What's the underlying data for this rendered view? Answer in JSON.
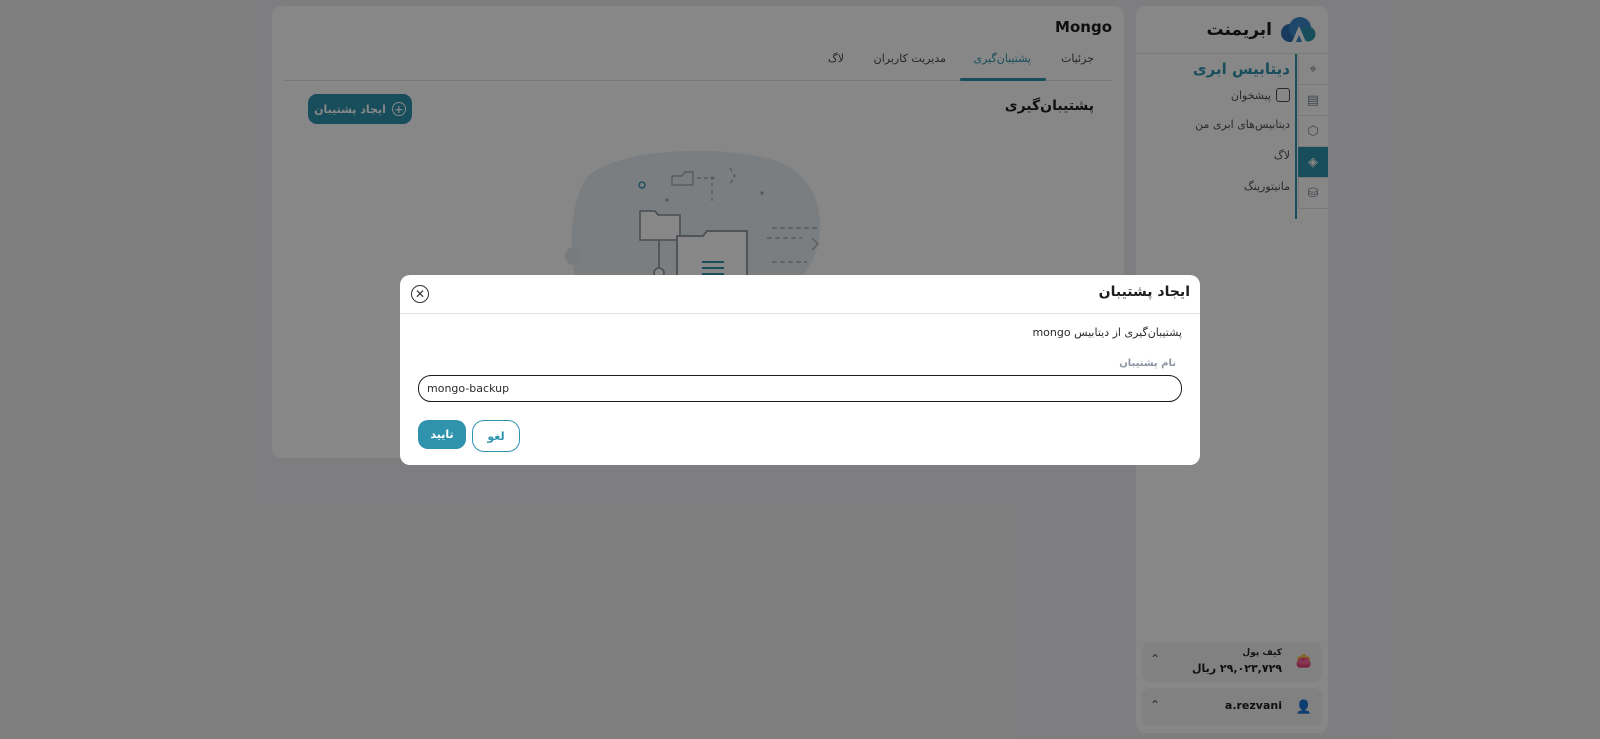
{
  "brand": {
    "name": "ابریمنت",
    "accent": "#2f93ae"
  },
  "sidebar": {
    "section_title": "دیتابیس ابری",
    "items": [
      {
        "label": "پیشخوان",
        "icon": "dashboard-icon"
      },
      {
        "label": "دیتابیس‌های ابری من"
      },
      {
        "label": "لاگ"
      },
      {
        "label": "مانیتورینگ"
      }
    ],
    "rail_icons": [
      "crosshair-icon",
      "server-icon",
      "cube-icon",
      "layers-icon",
      "database-icon"
    ],
    "wallet": {
      "label": "کیف پول",
      "amount": "۲۹,۰۲۳,۷۲۹ ریال"
    },
    "user": {
      "name": "a.rezvani"
    }
  },
  "main": {
    "title": "Mongo",
    "tabs": [
      {
        "label": "جزئیات"
      },
      {
        "label": "پشتیبان‌گیری",
        "active": true
      },
      {
        "label": "مدیریت کاربران"
      },
      {
        "label": "لاگ"
      }
    ],
    "section_title": "پشتیبان‌گیری",
    "create_button": "ایجاد پشتیبان"
  },
  "modal": {
    "title": "ایجاد پشتیبان",
    "description": "پشتیبان‌گیری از دیتابیس mongo",
    "field_label": "نام پشتیبان",
    "field_value": "mongo-backup",
    "confirm": "تایید",
    "cancel": "لغو"
  }
}
